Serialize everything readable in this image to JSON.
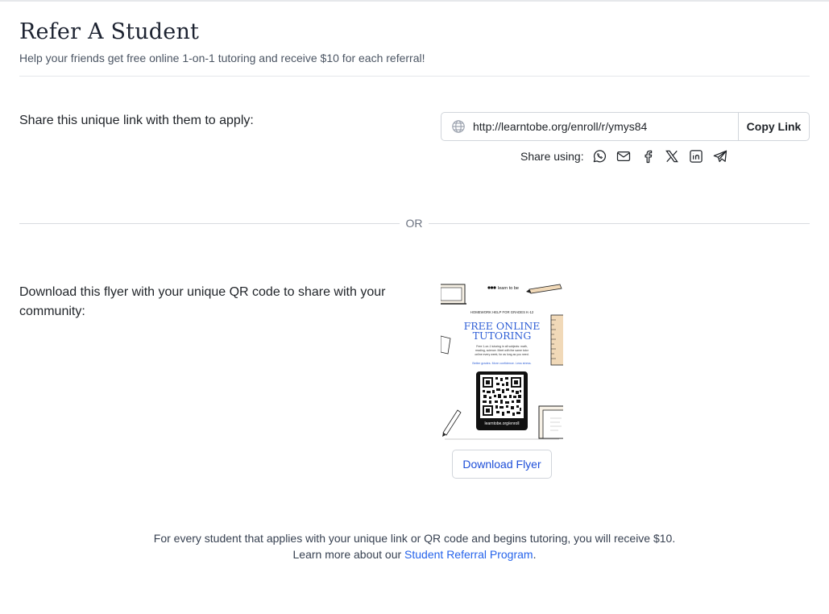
{
  "header": {
    "title": "Refer A Student",
    "subtitle": "Help your friends get free online 1-on-1 tutoring and receive $10 for each referral!"
  },
  "share": {
    "label": "Share this unique link with them to apply:",
    "link": "http://learntobe.org/enroll/r/ymys84",
    "copy_button": "Copy Link",
    "share_using": "Share using:",
    "icons": [
      "whatsapp-icon",
      "mail-icon",
      "facebook-icon",
      "x-icon",
      "linkedin-icon",
      "telegram-icon"
    ]
  },
  "divider": {
    "or": "OR"
  },
  "flyer": {
    "label": "Download this flyer with your unique QR code to share with your community:",
    "download_button": "Download Flyer",
    "thumbnail": {
      "brand": "learn to be",
      "grades": "HOMEWORK HELP FOR GRADES K-12",
      "headline_1": "FREE ONLINE",
      "headline_2": "TUTORING",
      "body_1": "Free 1-on-1 tutoring in all subjects: math,",
      "body_2": "reading, science. Meet with the same tutor",
      "body_3": "online every week, for as long as you need.",
      "tagline": "Better grades. More confidence. Less stress.",
      "qr_url": "learntobe.org/enroll"
    }
  },
  "footer": {
    "line1": "For every student that applies with your unique link or QR code and begins tutoring, you will receive $10.",
    "line2_prefix": "Learn more about our ",
    "link_text": "Student Referral Program",
    "line2_suffix": "."
  },
  "colors": {
    "accent": "#2563eb",
    "flyer_blue": "#2f5fd6",
    "flyer_tan": "#f1d9b8"
  }
}
